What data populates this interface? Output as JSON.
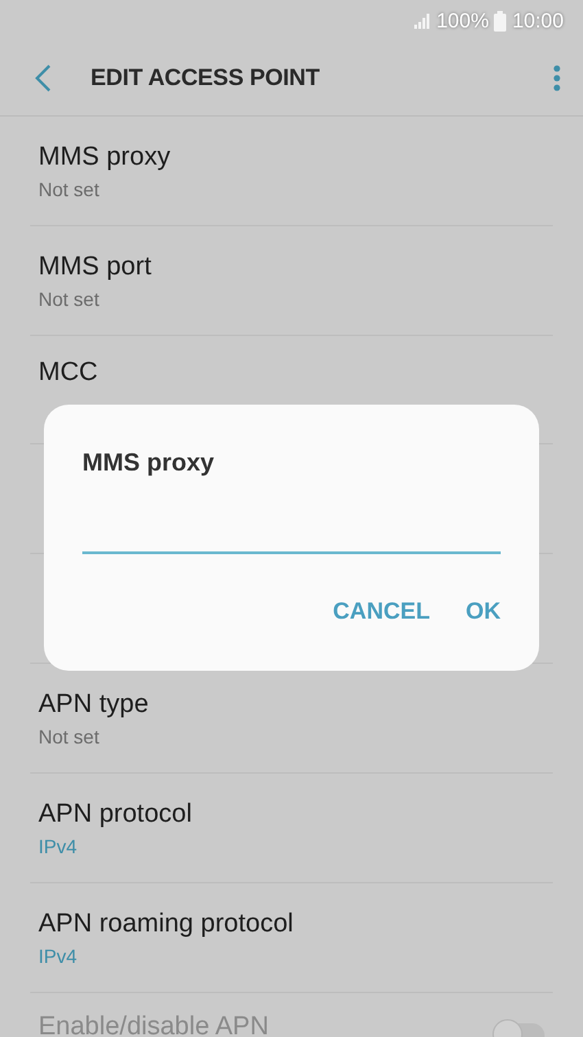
{
  "status_bar": {
    "battery": "100%",
    "time": "10:00"
  },
  "header": {
    "title": "EDIT ACCESS POINT"
  },
  "settings": [
    {
      "kind": "plain",
      "title": "MMS proxy",
      "value": "Not set"
    },
    {
      "kind": "plain",
      "title": "MMS port",
      "value": "Not set"
    },
    {
      "kind": "title_only",
      "title": "MCC"
    },
    {
      "kind": "covered"
    },
    {
      "kind": "covered"
    },
    {
      "kind": "plain",
      "title": "APN type",
      "value": "Not set"
    },
    {
      "kind": "accent",
      "title": "APN protocol",
      "value": "IPv4"
    },
    {
      "kind": "accent",
      "title": "APN roaming protocol",
      "value": "IPv4"
    },
    {
      "kind": "switch",
      "title": "Enable/disable APN",
      "disabled": true,
      "on": false
    }
  ],
  "dialog": {
    "title": "MMS proxy",
    "buttons": [
      "CANCEL",
      "OK"
    ]
  }
}
